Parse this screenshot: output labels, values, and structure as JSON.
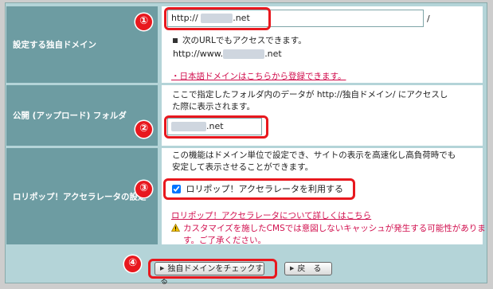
{
  "domain_row": {
    "label": "設定する独自ドメイン",
    "prefix": "http://",
    "value_suffix": ".net",
    "slash": "/",
    "note": "次のURLでもアクセスできます。",
    "alt_prefix": "http://www.",
    "alt_suffix": ".net",
    "link": "・日本語ドメインはこちらから登録できます。"
  },
  "folder_row": {
    "label": "公開 (アップロード) フォルダ",
    "description_line1": "ここで指定したフォルダ内のデータが http://独自ドメイン/ にアクセスし",
    "description_line2": "た際に表示されます。",
    "value_suffix": ".net"
  },
  "accelerator_row": {
    "label": "ロリポップ！アクセラレータの設定",
    "description_line1": "この機能はドメイン単位で設定でき、サイトの表示を高速化し高負荷時でも",
    "description_line2": "安定して表示させることができます。",
    "checkbox_label": "ロリポップ！アクセラレータを利用する",
    "checked": true,
    "link": "ロリポップ！アクセラレータについて詳しくはこちら",
    "warning_line1": "カスタマイズを施したCMSでは意図しないキャッシュが発生する可能性がありま",
    "warning_line2": "す。ご了承ください。"
  },
  "buttons": {
    "check": "独自ドメインをチェックする",
    "back": "戻　る"
  },
  "markers": [
    "①",
    "②",
    "③",
    "④"
  ],
  "colors": {
    "highlight": "#e8181e",
    "label_bg": "#6d9ca2",
    "link": "#d10f4e",
    "frame_bg": "#b4d4d8"
  }
}
